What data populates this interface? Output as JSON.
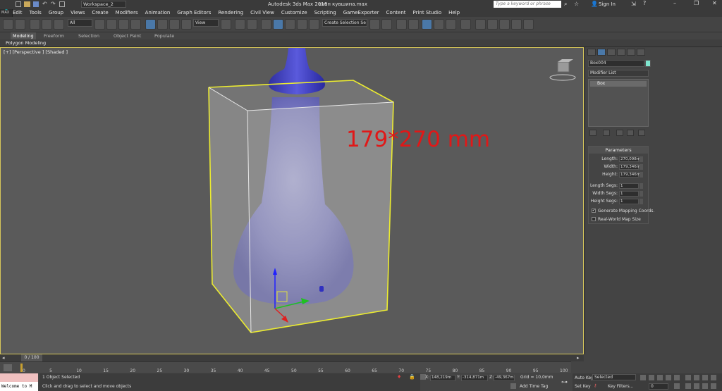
{
  "window": {
    "app_title": "Autodesk 3ds Max 2016",
    "file_title": "скан кувшина.max",
    "workspace": "Workspace_2",
    "search_placeholder": "Type a keyword or phrase",
    "sign_in": "Sign In",
    "logo_text": "MAX"
  },
  "menu": [
    "Edit",
    "Tools",
    "Group",
    "Views",
    "Create",
    "Modifiers",
    "Animation",
    "Graph Editors",
    "Rendering",
    "Civil View",
    "Customize",
    "Scripting",
    "GameExporter",
    "Content",
    "Print Studio",
    "Help"
  ],
  "toolbar": {
    "filter_value": "All",
    "ref_coord": "View",
    "selection_set": "Create Selection Se"
  },
  "ribbon": {
    "tabs": [
      "Modeling",
      "Freeform",
      "Selection",
      "Object Paint",
      "Populate"
    ],
    "active_tab": "Modeling",
    "panel_label": "Polygon Modeling"
  },
  "viewport": {
    "label": "[+] [Perspective ] [Shaded ]",
    "annotation": "179*270 mm"
  },
  "command_panel": {
    "object_name": "Box004",
    "object_color": "#7fe6cf",
    "modifier_list_label": "Modifier List",
    "stack_item": "Box",
    "params_header": "Parameters",
    "params": [
      {
        "label": "Length:",
        "value": "270,098m"
      },
      {
        "label": "Width:",
        "value": "179,346m"
      },
      {
        "label": "Height:",
        "value": "179,346m"
      }
    ],
    "segs": [
      {
        "label": "Length Segs:",
        "value": "1"
      },
      {
        "label": "Width Segs:",
        "value": "1"
      },
      {
        "label": "Height Segs:",
        "value": "1"
      }
    ],
    "gen_mapping_label": "Generate Mapping Coords.",
    "gen_mapping_checked": "✔",
    "real_world_label": "Real-World Map Size"
  },
  "timeline": {
    "slider_label": "0 / 100",
    "ticks": [
      "0",
      "5",
      "10",
      "15",
      "20",
      "25",
      "30",
      "35",
      "40",
      "45",
      "50",
      "55",
      "60",
      "65",
      "70",
      "75",
      "80",
      "85",
      "90",
      "95",
      "100"
    ]
  },
  "status": {
    "maxscript": "Welcome to M",
    "selected": "1 Object Selected",
    "prompt": "Click and drag to select and move objects",
    "x_label": "X:",
    "x": "148,219m",
    "y_label": "Y:",
    "y": "-314,871m",
    "z_label": "Z:",
    "z": "-49,367m",
    "grid": "Grid = 10,0mm",
    "add_time_tag": "Add Time Tag",
    "auto_key": "Auto Key",
    "auto_key_value": "Selected",
    "set_key": "Set Key",
    "key_filters": "Key Filters...",
    "frame": "0"
  }
}
